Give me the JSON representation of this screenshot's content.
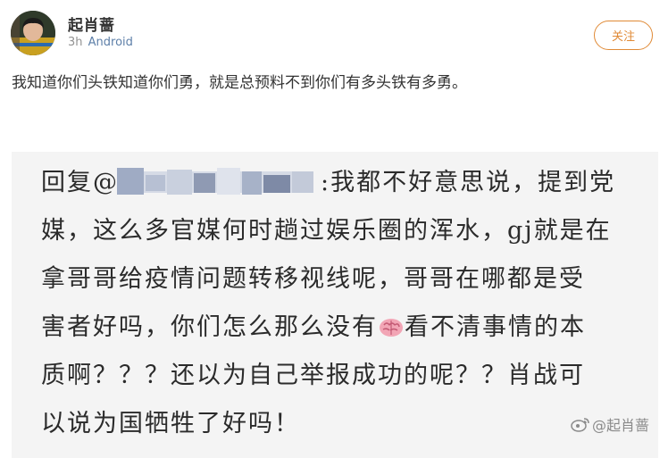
{
  "header": {
    "username": "起肖蔷",
    "time": "3h",
    "source": "Android",
    "follow_label": "关注"
  },
  "post": {
    "text": "我知道你们头铁知道你们勇，就是总预料不到你们有多头铁有多勇。"
  },
  "image": {
    "lines": [
      {
        "before": "回复@",
        "after": ":我都不好意思说，提到党"
      },
      {
        "text": "媒，这么多官媒何时趟过娱乐圈的浑水，gj就是在"
      },
      {
        "text": "拿哥哥给疫情问题转移视线呢，哥哥在哪都是受"
      },
      {
        "before": "害者好吗，你们怎么那么没有",
        "after": "看不清事情的本"
      },
      {
        "text": "质啊？？？还以为自己举报成功的呢？？肖战可"
      },
      {
        "text": "以说为国牺牲了好吗！"
      }
    ],
    "watermark": "@起肖蔷",
    "icons": [
      "brain-emoji-icon",
      "weibo-watermark-icon"
    ]
  },
  "colors": {
    "accent": "#e08a36",
    "source_link": "#5d7fa8",
    "image_bg": "#f4f4f4"
  }
}
